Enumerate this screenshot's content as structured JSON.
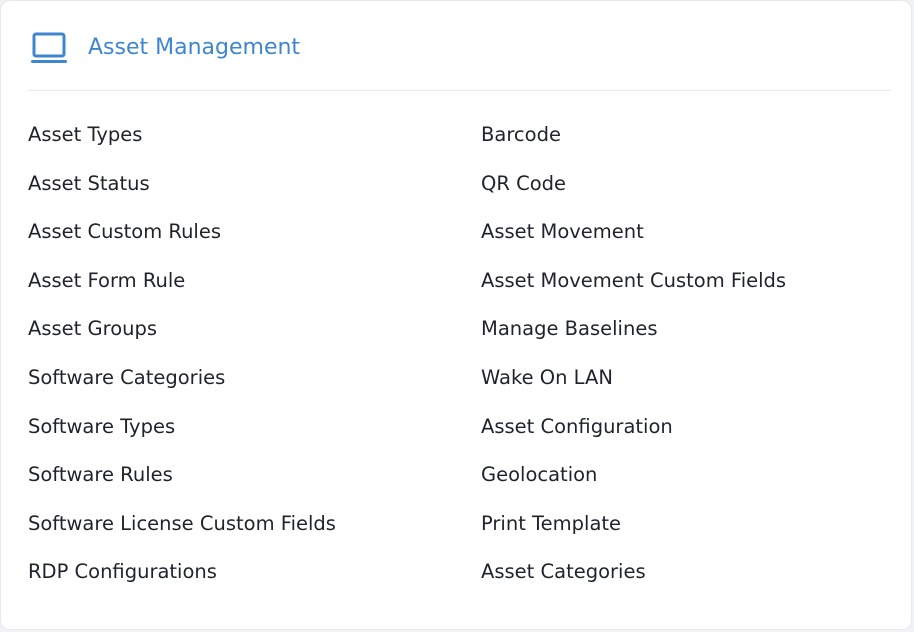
{
  "header": {
    "title": "Asset Management",
    "icon": "laptop-icon",
    "accent_color": "#3f86d0"
  },
  "left_links": [
    {
      "label": "Asset Types"
    },
    {
      "label": "Asset Status"
    },
    {
      "label": "Asset Custom Rules"
    },
    {
      "label": "Asset Form Rule"
    },
    {
      "label": "Asset Groups"
    },
    {
      "label": "Software Categories"
    },
    {
      "label": "Software Types"
    },
    {
      "label": "Software Rules"
    },
    {
      "label": "Software License Custom Fields"
    },
    {
      "label": "RDP Configurations"
    }
  ],
  "right_links": [
    {
      "label": "Barcode"
    },
    {
      "label": "QR Code"
    },
    {
      "label": "Asset Movement"
    },
    {
      "label": "Asset Movement Custom Fields"
    },
    {
      "label": "Manage Baselines"
    },
    {
      "label": "Wake On LAN"
    },
    {
      "label": "Asset Configuration"
    },
    {
      "label": "Geolocation"
    },
    {
      "label": "Print Template"
    },
    {
      "label": "Asset Categories"
    }
  ]
}
